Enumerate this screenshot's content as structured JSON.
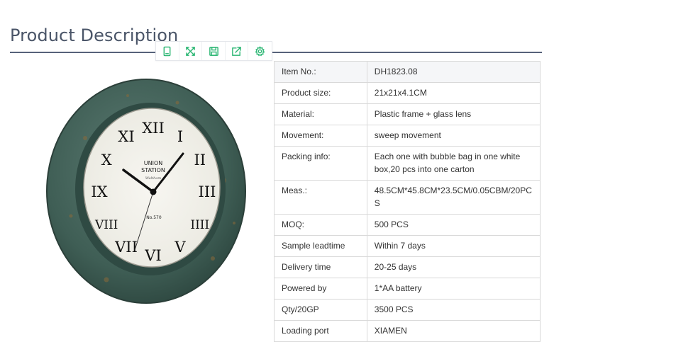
{
  "page": {
    "title": "Product Description"
  },
  "toolbar": [
    {
      "name": "copy-icon"
    },
    {
      "name": "fullscreen-icon"
    },
    {
      "name": "save-icon"
    },
    {
      "name": "share-icon"
    },
    {
      "name": "settings-icon"
    }
  ],
  "clock_image": {
    "brand_line1": "UNION",
    "brand_line2": "STATION",
    "brand_script": "Waltham",
    "model_no": "No.570",
    "numerals": [
      "XII",
      "I",
      "II",
      "III",
      "IIII",
      "V",
      "VI",
      "VII",
      "VIII",
      "IX",
      "X",
      "XI"
    ],
    "frame_color": "#3f5e55",
    "dial_color": "#f1efe8"
  },
  "specs": [
    {
      "label": "Item No.:",
      "value": "DH1823.08"
    },
    {
      "label": "Product size:",
      "value": "21x21x4.1CM"
    },
    {
      "label": "Material:",
      "value": "Plastic frame + glass lens"
    },
    {
      "label": "Movement:",
      "value": "sweep movement"
    },
    {
      "label": "Packing info:",
      "value": "Each one with bubble bag in one white box,20 pcs into one carton"
    },
    {
      "label": "Meas.:",
      "value": "48.5CM*45.8CM*23.5CM/0.05CBM/20PCS"
    },
    {
      "label": "MOQ:",
      "value": "500 PCS"
    },
    {
      "label": "Sample leadtime",
      "value": "Within 7 days"
    },
    {
      "label": "Delivery time",
      "value": "20-25 days"
    },
    {
      "label": "Powered by",
      "value": "1*AA battery"
    },
    {
      "label": "Qty/20GP",
      "value": "3500 PCS"
    },
    {
      "label": "Loading port",
      "value": "XIAMEN"
    }
  ]
}
